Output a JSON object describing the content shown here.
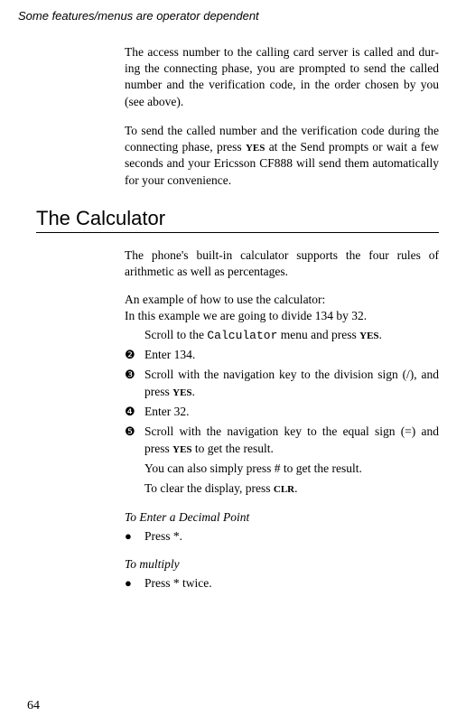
{
  "header": "Some features/menus are operator dependent",
  "para1": "The access number to the calling card server is called and dur­ing the connecting phase, you are prompted to send the called number and the verification code, in the order chosen by you (see above).",
  "para2_a": "To send the called number and the verification code during the connecting phase, press ",
  "para2_yes": "YES",
  "para2_b": " at the Send prompts or wait a few seconds and your Ericsson CF888 will send them auto­matically for your convenience.",
  "section_title": "The Calculator",
  "calc_intro": "The phone's built-in calculator supports the four rules of arithmetic as well as percentages.",
  "example_lead": "An example of how to use the calculator:",
  "example_line": "In this example we are going to divide 134 by 32.",
  "steps": {
    "s1_a": "Scroll to the ",
    "s1_mono": "Calculator",
    "s1_b": " menu and press ",
    "s1_yes": "YES",
    "s1_c": ".",
    "s2": "Enter 134.",
    "s3_a": "Scroll with the navigation key to the division sign (/), and press ",
    "s3_yes": "YES",
    "s3_b": ".",
    "s4": "Enter 32.",
    "s5_a": "Scroll with the navigation key to the equal sign (=) and press ",
    "s5_yes": "YES",
    "s5_b": " to get the result.",
    "s6": "You can also simply press # to get the result.",
    "s7_a": "To clear the display, press ",
    "s7_clr": "CLR",
    "s7_b": "."
  },
  "sub1_title": "To Enter a Decimal Point",
  "sub1_item": "Press *.",
  "sub2_title": "To multiply",
  "sub2_item": "Press * twice.",
  "page_number": "64"
}
